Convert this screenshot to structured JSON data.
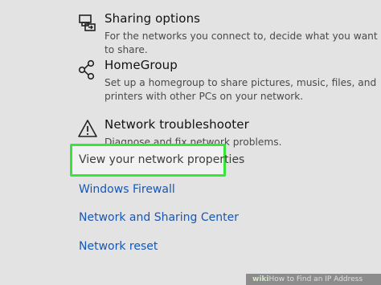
{
  "settings": [
    {
      "title": "Sharing options",
      "description": "For the networks you connect to, decide what you want to share.",
      "icon": "sharing-options-icon"
    },
    {
      "title": "HomeGroup",
      "description": "Set up a homegroup to share pictures, music, files, and printers with other PCs on your network.",
      "icon": "homegroup-icon"
    },
    {
      "title": "Network troubleshooter",
      "description": "Diagnose and fix network problems.",
      "icon": "warning-triangle-icon"
    }
  ],
  "highlighted_link": "View your network properties",
  "links": [
    "Windows Firewall",
    "Network and Sharing Center",
    "Network reset"
  ],
  "watermark": {
    "brand": "wiki",
    "text": "How to Find an IP Address"
  },
  "colors": {
    "background": "#e3e3e3",
    "link": "#1656b8",
    "highlight_border": "#39e53a"
  }
}
